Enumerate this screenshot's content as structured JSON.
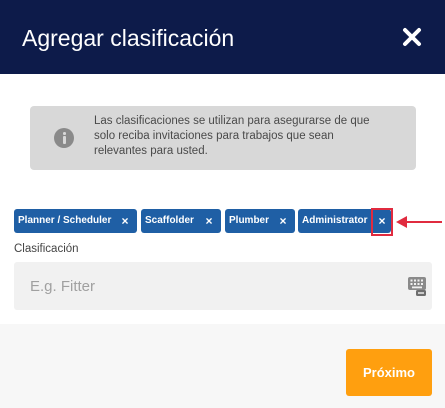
{
  "header": {
    "title": "Agregar clasificación",
    "close_icon": "close-icon"
  },
  "info": {
    "icon": "info-icon",
    "text": "Las clasificaciones se utilizan para asegurarse de que solo reciba invitaciones para trabajos que sean relevantes para usted."
  },
  "chips": [
    {
      "label": "Planner / Scheduler",
      "remove": "×"
    },
    {
      "label": "Scaffolder",
      "remove": "×"
    },
    {
      "label": "Plumber",
      "remove": "×"
    },
    {
      "label": "Administrator",
      "remove": "×"
    }
  ],
  "field": {
    "label": "Clasificación",
    "placeholder": "E.g. Fitter",
    "value": "",
    "icon": "keyboard-icon"
  },
  "footer": {
    "next_label": "Próximo"
  },
  "colors": {
    "header_bg": "#0d1b4a",
    "chip_bg": "#1f5fa5",
    "accent": "#ff9f0f",
    "highlight": "#e02b3f"
  }
}
